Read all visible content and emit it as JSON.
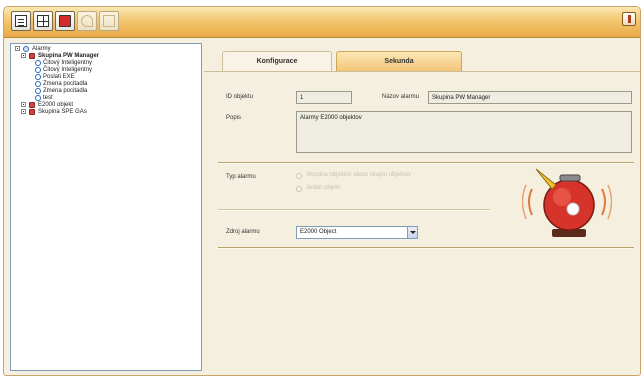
{
  "toolbar": {
    "buttons": [
      {
        "icon": "list-icon"
      },
      {
        "icon": "grid-icon"
      },
      {
        "icon": "delete-icon"
      },
      {
        "icon": "undo-icon"
      },
      {
        "icon": "save-icon"
      }
    ],
    "close_icon": "close-icon"
  },
  "tree": {
    "root": "Alarmy",
    "group1": "Skupina PW Manager",
    "group1_items": [
      "Čitový Inteligentny",
      "Čitový Inteligentny",
      "Poslati EXE",
      "Zmena pocitadla",
      "Zmena pocitadla",
      "test"
    ],
    "group2": "E2000 objekt",
    "group3": "Skupina SPE GAs"
  },
  "tabs": {
    "konfigurace": "Konfigurace",
    "sekunda": "Sekunda"
  },
  "form": {
    "id_label": "ID objektu",
    "id_value": "1",
    "name_label": "Názov alarmu",
    "name_value": "Skupina PW Manager",
    "desc_label": "Popis",
    "desc_value": "Alarmy E2000 objektov",
    "type_label": "Typ alarmu",
    "radio1": "Skupina objektov alebo skupin objektov",
    "radio2": "Jeden objekt",
    "source_label": "Zdroj alarmu",
    "source_value": "E2000 Object"
  },
  "colors": {
    "accent": "#e9a945",
    "panel": "#f4efdf",
    "alarm": "#d6342a"
  }
}
